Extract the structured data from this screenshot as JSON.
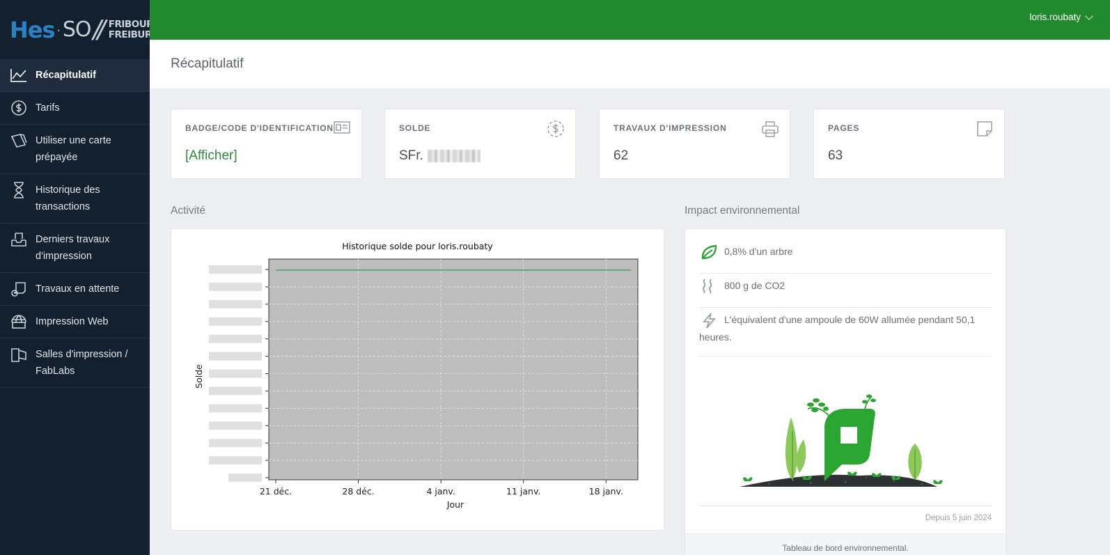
{
  "brand": {
    "hes": "Hes",
    "dot": "·",
    "so": "SO",
    "slash": "//",
    "city_line1": "FRIBOURG",
    "city_line2": "FREIBURG"
  },
  "sidebar": {
    "items": [
      {
        "label": "Récapitulatif",
        "icon": "line-chart-icon",
        "active": true
      },
      {
        "label": "Tarifs",
        "icon": "dollar-circle-icon"
      },
      {
        "label": "Utiliser une carte prépayée",
        "icon": "cards-icon"
      },
      {
        "label": "Historique des transactions",
        "icon": "hourglass-icon"
      },
      {
        "label": "Derniers travaux d'impression",
        "icon": "inbox-tray-icon"
      },
      {
        "label": "Travaux en attente",
        "icon": "printer-pending-icon"
      },
      {
        "label": "Impression Web",
        "icon": "globe-print-icon"
      },
      {
        "label": "Salles d'impression / FabLabs",
        "icon": "room-flag-icon"
      }
    ]
  },
  "topbar": {
    "username": "loris.roubaty",
    "color": "#218a2e"
  },
  "page": {
    "title": "Récapitulatif"
  },
  "stats": [
    {
      "label": "BADGE/CODE D'IDENTIFICATION",
      "value": "[Afficher]",
      "icon": "id-card-icon"
    },
    {
      "label": "SOLDE",
      "value": "SFr.",
      "icon": "dollar-dashed-circle-icon"
    },
    {
      "label": "TRAVAUX D'IMPRESSION",
      "value": "62",
      "icon": "printer-icon"
    },
    {
      "label": "PAGES",
      "value": "63",
      "icon": "page-icon"
    }
  ],
  "sections": {
    "activity": "Activité",
    "environment": "Impact environnemental"
  },
  "chart_data": {
    "type": "line",
    "title": "Historique solde pour loris.roubaty",
    "xlabel": "Jour",
    "ylabel": "Solde",
    "x_ticks": [
      "21 déc.",
      "28 déc.",
      "4 janv.",
      "11 janv.",
      "18 janv."
    ],
    "y_tick_count": 13,
    "series": [
      {
        "color": "#2e9b3e",
        "x": [
          "21 déc.",
          "18 janv."
        ],
        "y_level_fraction": [
          0.95,
          0.95
        ]
      }
    ],
    "grid": true,
    "plot_background": "#bdbdbd",
    "y_labels_redacted": true
  },
  "environment": {
    "items": [
      {
        "text": "0,8% d'un arbre",
        "icon": "leaf-icon"
      },
      {
        "text": "800 g de CO2",
        "icon": "steam-icon"
      },
      {
        "text": "L'équivalent d'une ampoule de 60W allumée pendant 50,1 heures.",
        "icon": "lightning-icon"
      }
    ],
    "since": "Depuis 5 juin 2024",
    "dashboard_link": "Tableau de bord environnemental.",
    "accent": "#2aa52f"
  }
}
